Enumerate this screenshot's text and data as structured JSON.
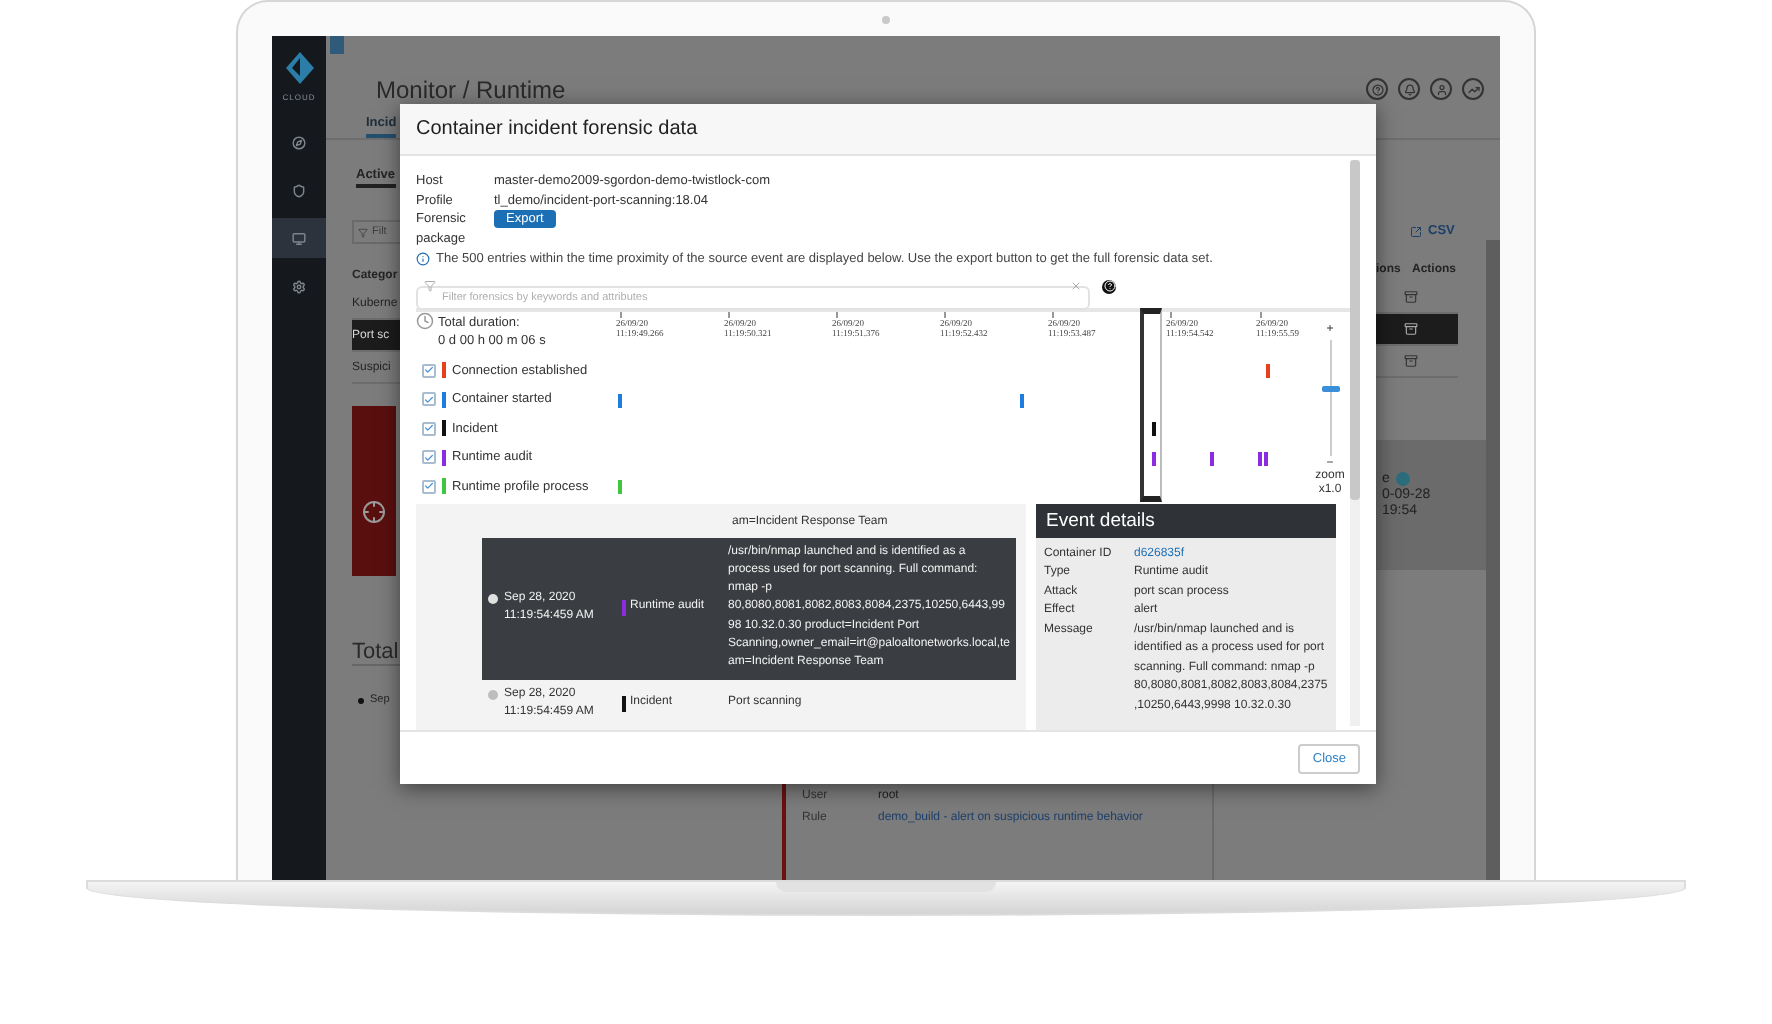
{
  "sidebar": {
    "logo_text": "CLOUD",
    "items": [
      {
        "selected": false
      },
      {
        "selected": false
      },
      {
        "selected": true
      },
      {
        "selected": false
      }
    ]
  },
  "app": {
    "title": "Monitor / Runtime",
    "tabs": [
      {
        "label": "Incid",
        "selected": true
      }
    ],
    "subtabs": [
      {
        "label": "Active",
        "selected": true
      }
    ],
    "filter": {
      "placeholder": "Filt"
    },
    "csv_link": "CSV",
    "table": {
      "columns": [
        "Categor",
        "ions",
        "Actions"
      ],
      "rows": [
        {
          "category": "Kuberne",
          "selected": false
        },
        {
          "category": "Port sc",
          "selected": true
        },
        {
          "category": "Suspici",
          "selected": false
        }
      ]
    },
    "side_panel": {
      "label": "e",
      "lines": [
        "0-09-28",
        "19:54"
      ]
    },
    "total_heading": "Total",
    "list_items": [
      "Sep"
    ],
    "details": [
      {
        "label": "User",
        "value": "root",
        "kind": "text"
      },
      {
        "label": "Rule",
        "value": "demo_build - alert on suspicious runtime behavior",
        "kind": "link"
      }
    ]
  },
  "modal": {
    "title": "Container incident forensic data",
    "info": [
      {
        "label": "Host",
        "value": "master-demo2009-sgordon-demo-twistlock-com",
        "kind": "text"
      },
      {
        "label": "Profile",
        "value": "tl_demo/incident-port-scanning:18.04",
        "kind": "text"
      },
      {
        "label": "Forensic package",
        "value": "Export",
        "kind": "button"
      }
    ],
    "notice": "The 500 entries within the time proximity of the source event are displayed below. Use the export button to get the full forensic data set.",
    "filter": {
      "placeholder": "Filter forensics by keywords and attributes"
    },
    "timeline": {
      "duration_label": "Total duration:",
      "duration": "0 d 00 h 00 m 06 s",
      "ticks": [
        {
          "date": "26/09/20",
          "time": "11:19:49.266"
        },
        {
          "date": "26/09/20",
          "time": "11:19:50.321"
        },
        {
          "date": "26/09/20",
          "time": "11:19:51.376"
        },
        {
          "date": "26/09/20",
          "time": "11:19:52.432"
        },
        {
          "date": "26/09/20",
          "time": "11:19:53.487"
        },
        {
          "date": "26/09/20",
          "time": "11:19:54.542"
        },
        {
          "date": "26/09/20",
          "time": "11:19:55.59"
        }
      ],
      "categories": [
        {
          "label": "Connection established",
          "checked": true,
          "color": "#e8401c"
        },
        {
          "label": "Container started",
          "checked": true,
          "color": "#1e7be0"
        },
        {
          "label": "Incident",
          "checked": true,
          "color": "#111111"
        },
        {
          "label": "Runtime audit",
          "checked": true,
          "color": "#8b2be2"
        },
        {
          "label": "Runtime profile process",
          "checked": true,
          "color": "#3fc53f"
        }
      ],
      "zoom": {
        "plus": "+",
        "minus": "−",
        "label": "zoom",
        "value": "x1.0",
        "level": 0.6
      }
    },
    "events": [
      {
        "kind": "partial",
        "message": "am=Incident Response Team"
      },
      {
        "kind": "event",
        "date": "Sep 28, 2020",
        "time": "11:19:54:459 AM",
        "type": "Runtime audit",
        "color": "#8b2be2",
        "message": "/usr/bin/nmap launched and is identified as a process used for port scanning. Full command: nmap -p 80,8080,8081,8082,8083,8084,2375,10250,6443,9998 10.32.0.30 product=Incident Port Scanning,owner_email=irt@paloaltonetworks.local,team=Incident Response Team",
        "selected": true
      },
      {
        "kind": "event",
        "date": "Sep 28, 2020",
        "time": "11:19:54:459 AM",
        "type": "Incident",
        "color": "#111111",
        "message": "Port scanning",
        "selected": false
      }
    ],
    "details": {
      "title": "Event details",
      "rows": [
        {
          "label": "Container ID",
          "value": "d626835f",
          "kind": "link"
        },
        {
          "label": "Type",
          "value": "Runtime audit",
          "kind": "text"
        },
        {
          "label": "Attack",
          "value": "port scan process",
          "kind": "text"
        },
        {
          "label": "Effect",
          "value": "alert",
          "kind": "text"
        },
        {
          "label": "Message",
          "value": "/usr/bin/nmap launched and is identified as a process used for port scanning. Full command: nmap -p 80,8080,8081,8082,8083,8084,2375,10250,6443,9998 10.32.0.30",
          "kind": "text"
        }
      ]
    },
    "close_button": "Close"
  }
}
